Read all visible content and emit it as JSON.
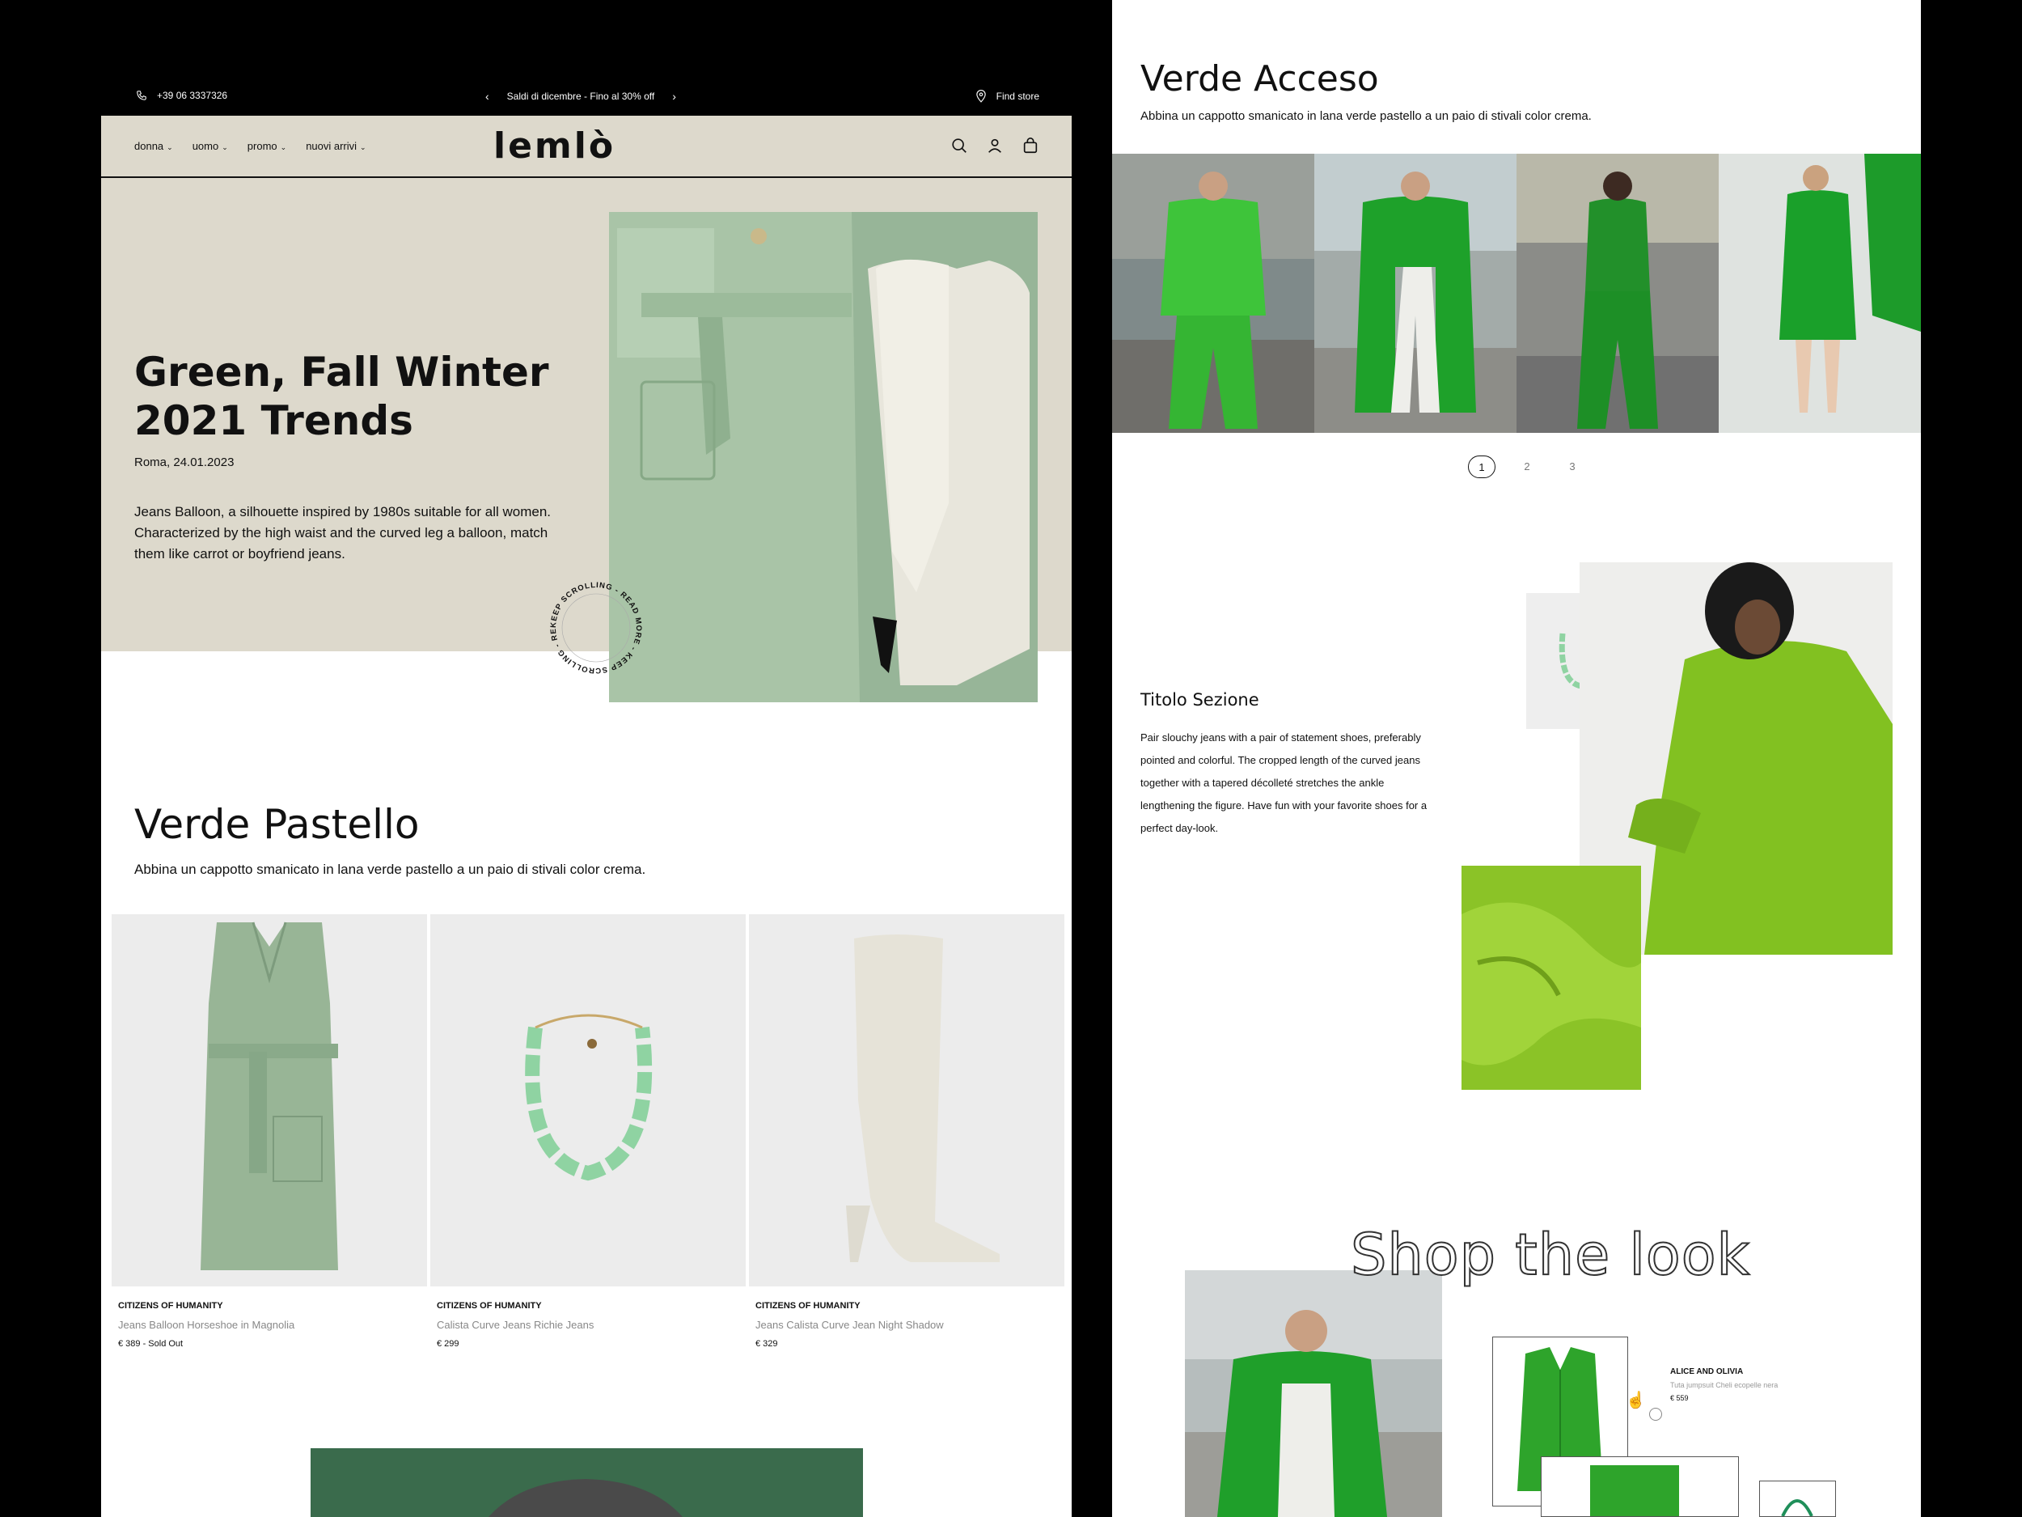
{
  "topbar": {
    "phone_icon": "phone-icon",
    "phone": "+39 06 3337326",
    "promo": "Saldi di dicembre - Fino al 30% off",
    "store_icon": "location-pin-icon",
    "store": "Find store"
  },
  "header": {
    "logo": "lemlò",
    "nav": [
      {
        "label": "donna"
      },
      {
        "label": "uomo"
      },
      {
        "label": "promo"
      },
      {
        "label": "nuovi arrivi"
      }
    ]
  },
  "hero": {
    "title": "Green, Fall Winter 2021 Trends",
    "date": "Roma, 24.01.2023",
    "description": "Jeans Balloon, a silhouette inspired by 1980s suitable for all women. Characterized by the high waist and the curved leg a balloon, match them like carrot or boyfriend jeans.",
    "badge_text": "KEEP SCROLLING - READ MORE - KEEP SCROLLING - READ MORE -"
  },
  "verde_pastello": {
    "title": "Verde Pastello",
    "subtitle": "Abbina un cappotto smanicato in lana verde pastello a un paio di stivali color crema.",
    "products": [
      {
        "brand": "CITIZENS OF HUMANITY",
        "name": "Jeans Balloon Horseshoe in Magnolia",
        "price": "€ 389 - Sold Out"
      },
      {
        "brand": "CITIZENS OF HUMANITY",
        "name": "Calista Curve Jeans Richie Jeans",
        "price": "€ 299"
      },
      {
        "brand": "CITIZENS OF HUMANITY",
        "name": "Jeans Calista Curve Jean Night Shadow",
        "price": "€ 329"
      }
    ]
  },
  "verde_acceso": {
    "title": "Verde Acceso",
    "subtitle": "Abbina un cappotto smanicato in lana verde pastello a un paio di stivali color crema.",
    "pager": [
      "1",
      "2",
      "3"
    ]
  },
  "section": {
    "title": "Titolo Sezione",
    "text": "Pair slouchy jeans with a pair of statement shoes, preferably pointed and colorful. The cropped length of the curved jeans together with a tapered décolleté stretches the ankle lengthening the figure. Have fun with your favorite shoes for a perfect day-look."
  },
  "shop_the_look": {
    "title": "Shop the look",
    "product": {
      "brand": "ALICE AND OLIVIA",
      "name": "Tuta jumpsuit Cheli ecopelle nera",
      "price": "€ 559"
    }
  },
  "colors": {
    "beige": "#ddd9cc",
    "pastel_green": "#97b598",
    "bright_green": "#2e9e2a",
    "lime": "#8cc63f"
  }
}
